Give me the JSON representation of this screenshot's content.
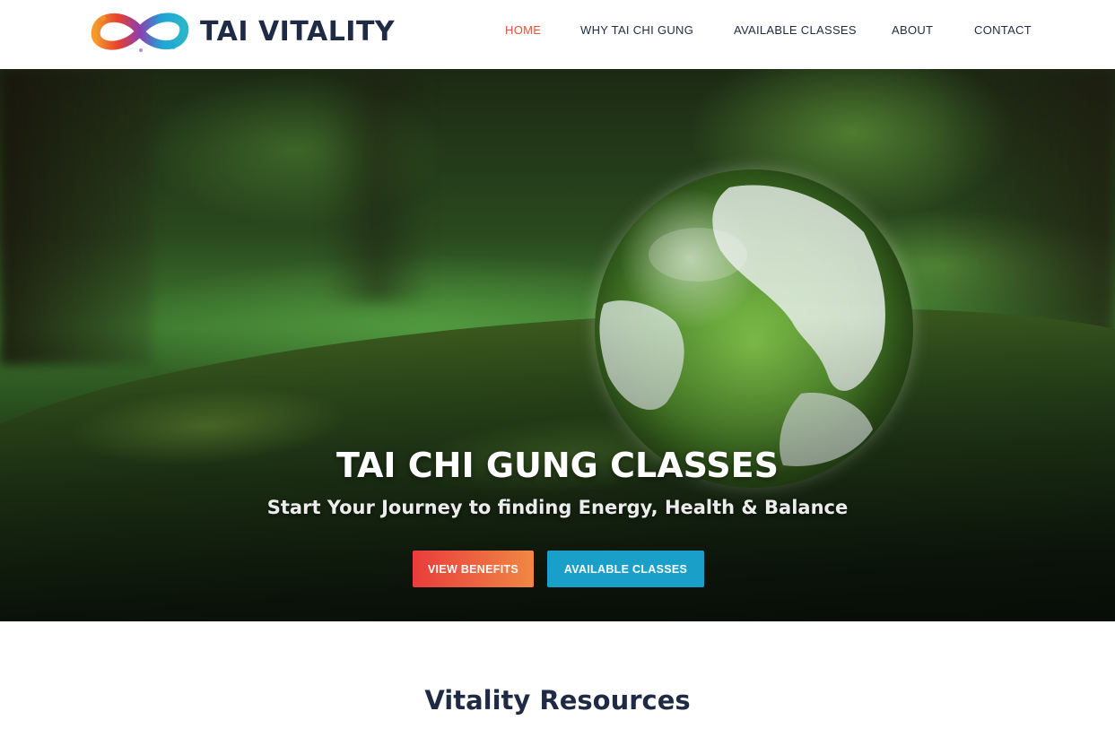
{
  "brand": {
    "name": "TAI VITALITY",
    "logo_icon": "infinity-icon",
    "colors": [
      "#e8412e",
      "#f39a2b",
      "#1fa5d6",
      "#8c3fb0"
    ]
  },
  "nav": {
    "items": [
      {
        "label": "HOME",
        "active": true
      },
      {
        "label": "WHY TAI CHI GUNG",
        "active": false
      },
      {
        "label": "AVAILABLE CLASSES",
        "active": false
      },
      {
        "label": "ABOUT",
        "active": false
      },
      {
        "label": "CONTACT",
        "active": false
      }
    ],
    "active_color": "#e3503e",
    "text_color": "#1f2a44"
  },
  "hero": {
    "title": "TAI CHI GUNG CLASSES",
    "subtitle": "Start Your Journey to finding Energy, Health & Balance",
    "image": "glass-globe-on-moss",
    "buttons": {
      "benefits": "VIEW BENEFITS",
      "classes": "AVAILABLE CLASSES"
    },
    "button_colors": {
      "benefits": "#ea3c3c",
      "classes": "#1a9fc9"
    }
  },
  "resources": {
    "title": "Vitality Resources"
  }
}
